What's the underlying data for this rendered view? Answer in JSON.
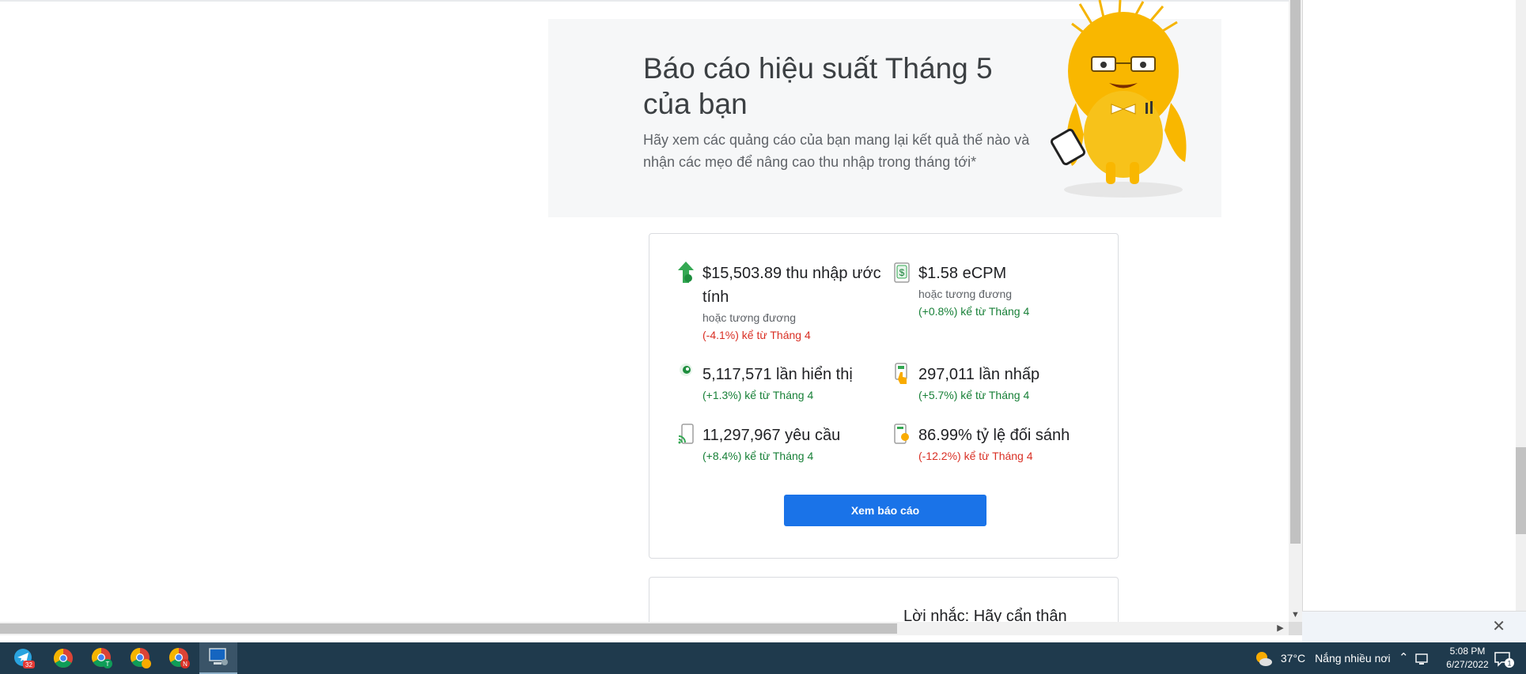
{
  "hero": {
    "title": "Báo cáo hiệu suất Tháng 5 của bạn",
    "subtitle": "Hãy xem các quảng cáo của bạn mang lại kết quả thế nào và nhận các mẹo để nâng cao thu nhập trong tháng tới*"
  },
  "metrics": [
    {
      "icon": "earnings-up-arrow-icon",
      "title": "$15,503.89 thu nhập ước tính",
      "note": "hoặc tương đương",
      "change": "(-4.1%) kể từ Tháng 4",
      "trend": "negative"
    },
    {
      "icon": "dollar-document-icon",
      "title": "$1.58 eCPM",
      "note": "hoặc tương đương",
      "change": "(+0.8%) kể từ Tháng 4",
      "trend": "positive"
    },
    {
      "icon": "eye-icon",
      "title": "5,117,571 lần hiển thị",
      "note": "",
      "change": "(+1.3%) kể từ Tháng 4",
      "trend": "positive"
    },
    {
      "icon": "tap-hand-icon",
      "title": "297,011 lần nhấp",
      "note": "",
      "change": "(+5.7%) kể từ Tháng 4",
      "trend": "positive"
    },
    {
      "icon": "phone-signal-icon",
      "title": "11,297,967 yêu cầu",
      "note": "",
      "change": "(+8.4%) kể từ Tháng 4",
      "trend": "positive"
    },
    {
      "icon": "match-rate-icon",
      "title": "86.99% tỷ lệ đối sánh",
      "note": "",
      "change": "(-12.2%) kể từ Tháng 4",
      "trend": "negative"
    }
  ],
  "cta": {
    "label": "Xem báo cáo"
  },
  "next_card": {
    "title": "Lời nhắc: Hãy cẩn thân"
  },
  "colors": {
    "accent": "#1a73e8",
    "positive": "#188038",
    "negative": "#d93025",
    "hero_bg": "#f6f7f8"
  },
  "taskbar": {
    "apps": [
      {
        "icon": "telegram-icon",
        "badge": "32"
      },
      {
        "icon": "chrome-icon",
        "badge": ""
      },
      {
        "icon": "chrome-profile-t-icon",
        "badge": "T"
      },
      {
        "icon": "chrome-profile-icon",
        "badge": ""
      },
      {
        "icon": "chrome-profile-n-icon",
        "badge": "N"
      },
      {
        "icon": "remote-desktop-icon",
        "badge": ""
      }
    ],
    "weather_temp": "37°C",
    "weather_text": "Nắng nhiều nơi",
    "time": "5:08 PM",
    "date": "6/27/2022",
    "notification_count": "1"
  }
}
